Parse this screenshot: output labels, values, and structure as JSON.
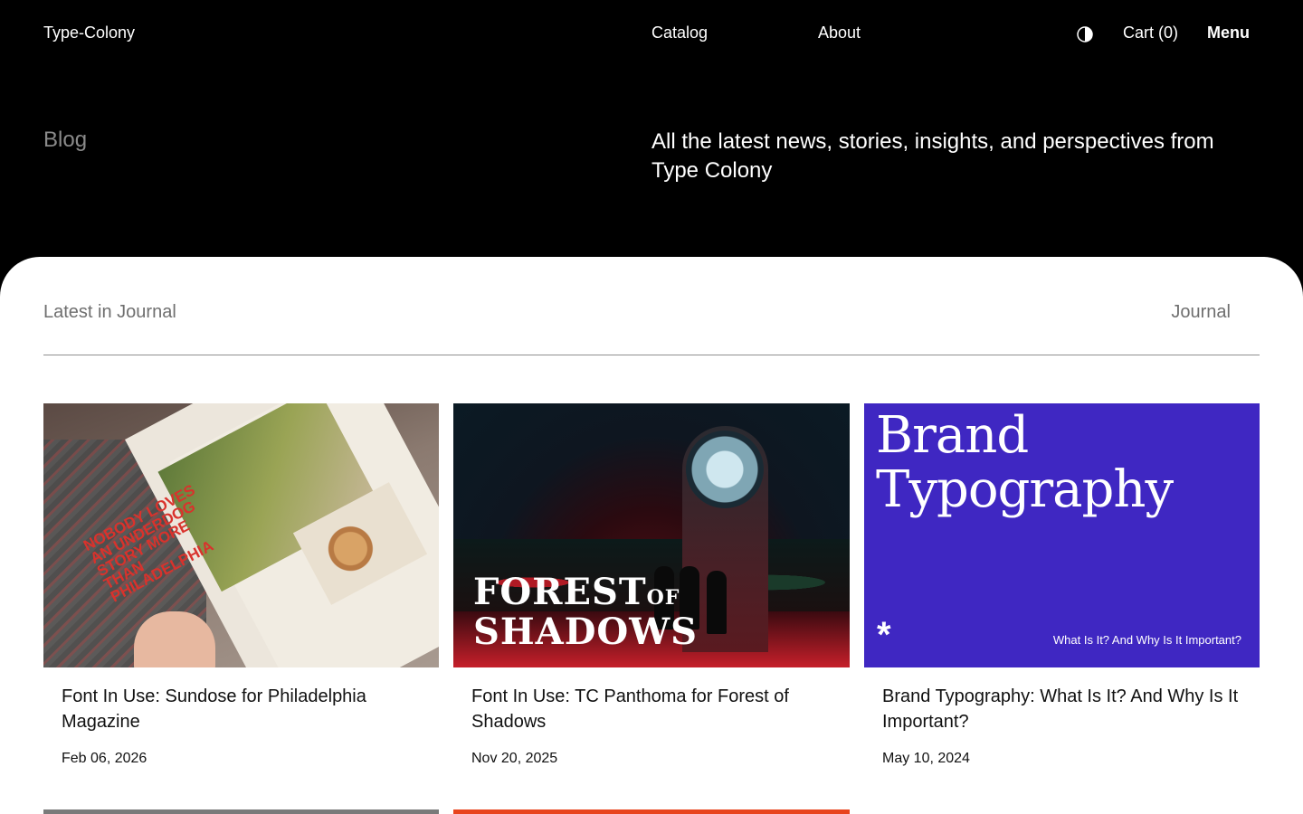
{
  "header": {
    "brand": "Type-Colony",
    "nav": [
      "Catalog",
      "About"
    ],
    "cart": "Cart (0)",
    "menu": "Menu",
    "theme_icon": "contrast-icon"
  },
  "hero": {
    "title": "Blog",
    "description": "All the latest news, stories, insights, and perspectives from Type Colony"
  },
  "section": {
    "label": "Latest in Journal",
    "link": "Journal"
  },
  "cards": [
    {
      "title": "Font In Use: Sundose for Philadelphia Magazine",
      "date": "Feb 06, 2026",
      "image_text": "NOBODY LOVES AN UNDERDOG STORY MORE THAN PHILADELPHIA"
    },
    {
      "title": "Font In Use: TC Panthoma for Forest of Shadows",
      "date": "Nov 20, 2025",
      "image_text": {
        "forest": "FOREST",
        "of": "OF",
        "shadows": "SHADOWS"
      }
    },
    {
      "title": "Brand Typography: What Is It? And Why Is It Important?",
      "date": "May 10, 2024",
      "image_text": {
        "line1": "Brand",
        "line2": "Typography",
        "tag": "What Is It? And Why Is It Important?",
        "mark": "*"
      }
    }
  ],
  "colors": {
    "background": "#000000",
    "panel": "#ffffff",
    "accent_purple": "#3f27c2",
    "accent_orange": "#e8441e"
  }
}
